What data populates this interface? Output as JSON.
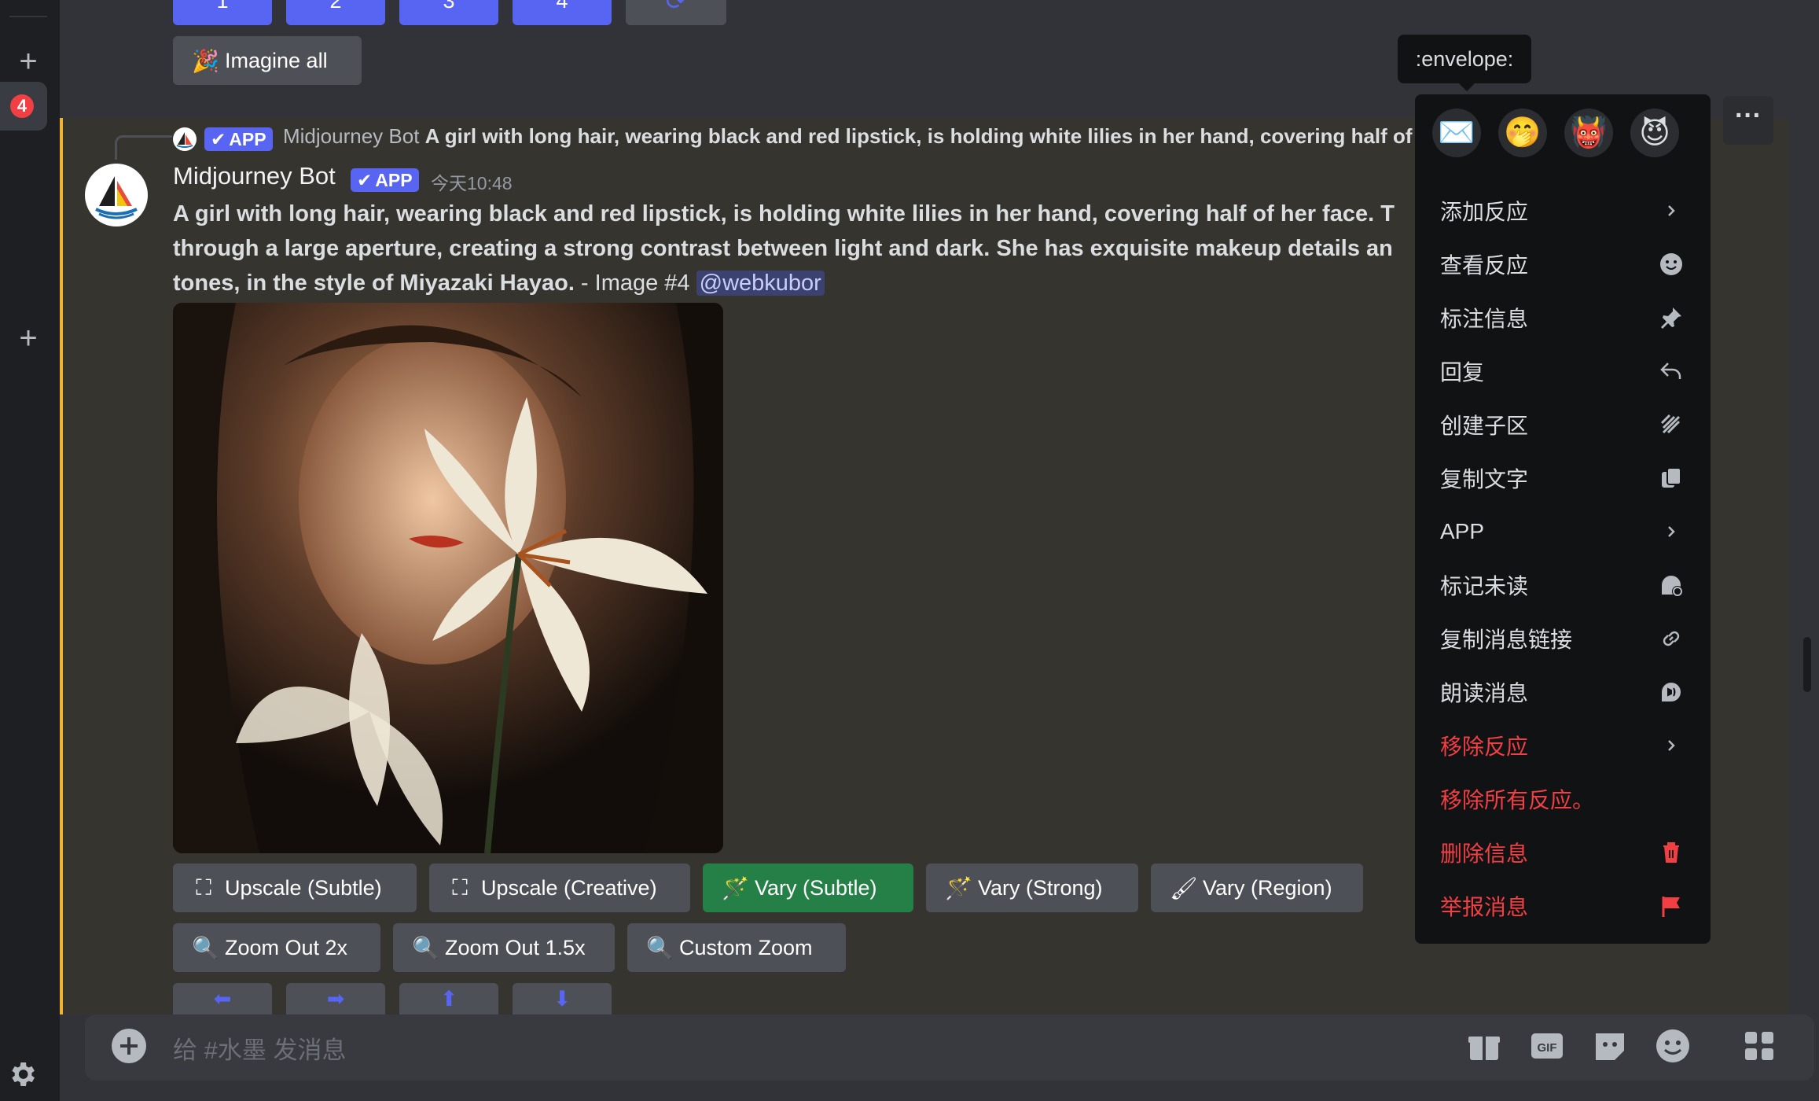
{
  "top_buttons": [
    "1",
    "2",
    "3",
    "4"
  ],
  "imagine_all": "Imagine all",
  "reply_ref": {
    "app": "APP",
    "bot": "Midjourney Bot",
    "text": "A girl with long hair, wearing black and red lipstick, is holding white lilies in her hand, covering half of"
  },
  "message": {
    "author": "Midjourney Bot",
    "app_tag": "APP",
    "timestamp": "今天10:48",
    "line1": "A girl with long hair, wearing black and red lipstick, is holding white lilies in her hand, covering half of her face. T",
    "line2": "through a large aperture, creating a strong contrast between light and dark. She has exquisite makeup details an",
    "line3": "tones, in the style of Miyazaki Hayao.",
    "suffix": " - Image #4 ",
    "mention": "@webkubor"
  },
  "action_buttons": {
    "upscale_subtle": "Upscale (Subtle)",
    "upscale_creative": "Upscale (Creative)",
    "vary_subtle": "Vary (Subtle)",
    "vary_strong": "Vary (Strong)",
    "vary_region": "Vary (Region)",
    "zoom_2x": "Zoom Out 2x",
    "zoom_15x": "Zoom Out 1.5x",
    "custom_zoom": "Custom Zoom"
  },
  "input": {
    "placeholder": "给 #水墨 发消息"
  },
  "rail": {
    "badge_count": "4"
  },
  "tooltip": ":envelope:",
  "context_menu": {
    "items": [
      {
        "label": "添加反应",
        "icon": "chevron-right-icon"
      },
      {
        "label": "查看反应",
        "icon": "smiley-icon"
      },
      {
        "label": "标注信息",
        "icon": "pin-icon"
      },
      {
        "label": "回复",
        "icon": "reply-icon"
      },
      {
        "label": "创建子区",
        "icon": "thread-icon"
      },
      {
        "label": "复制文字",
        "icon": "copy-icon"
      },
      {
        "label": "APP",
        "icon": "chevron-right-icon"
      },
      {
        "label": "标记未读",
        "icon": "mark-unread-icon"
      },
      {
        "label": "复制消息链接",
        "icon": "link-icon"
      },
      {
        "label": "朗读消息",
        "icon": "speak-icon"
      },
      {
        "label": "移除反应",
        "icon": "chevron-right-icon",
        "danger": true
      },
      {
        "label": "移除所有反应。",
        "icon": "",
        "danger": true
      },
      {
        "label": "删除信息",
        "icon": "trash-icon",
        "danger": true
      },
      {
        "label": "举报消息",
        "icon": "flag-icon",
        "danger": true
      }
    ]
  },
  "colors": {
    "brand": "#5865f2",
    "success": "#248046",
    "danger": "#f23f43",
    "highlight_bar": "#f0b232"
  }
}
